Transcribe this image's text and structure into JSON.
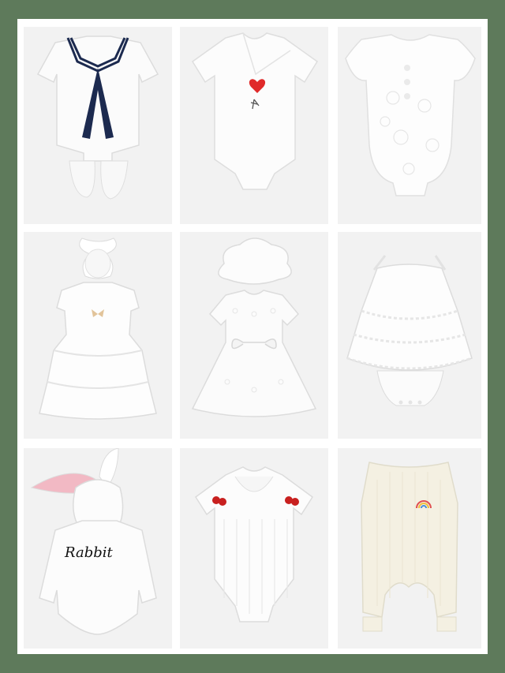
{
  "colors": {
    "frame": "#5e7a5b",
    "card": "#ffffff",
    "tile": "#f2f2f2",
    "navy": "#1c2a4f",
    "heart": "#e02a2a",
    "cherry": "#c8201f",
    "ear_pink": "#f2b9c4",
    "cream": "#f4f0e2"
  },
  "grid": {
    "rows": 3,
    "columns": 3
  },
  "products": [
    {
      "item": "sailor-collar-romper",
      "icon": "sailor-romper-icon"
    },
    {
      "item": "heart-embroidery-bodysuit",
      "icon": "heart-bodysuit-icon"
    },
    {
      "item": "lace-flutter-sleeve-bodysuit",
      "icon": "lace-bodysuit-icon"
    },
    {
      "item": "tiered-tulle-dress-with-headband",
      "icon": "tulle-dress-icon"
    },
    {
      "item": "eyelet-dress-with-bucket-hat",
      "icon": "eyelet-dress-icon"
    },
    {
      "item": "layered-lace-halter-romper",
      "icon": "lace-romper-icon"
    },
    {
      "item": "rabbit-hooded-romper",
      "icon": "rabbit-hoodie-icon",
      "print_text": "Rabbit"
    },
    {
      "item": "cherry-embroidered-romper",
      "icon": "cherry-romper-icon"
    },
    {
      "item": "ribbed-sleeveless-jumpsuit",
      "icon": "rainbow-jumpsuit-icon"
    }
  ]
}
